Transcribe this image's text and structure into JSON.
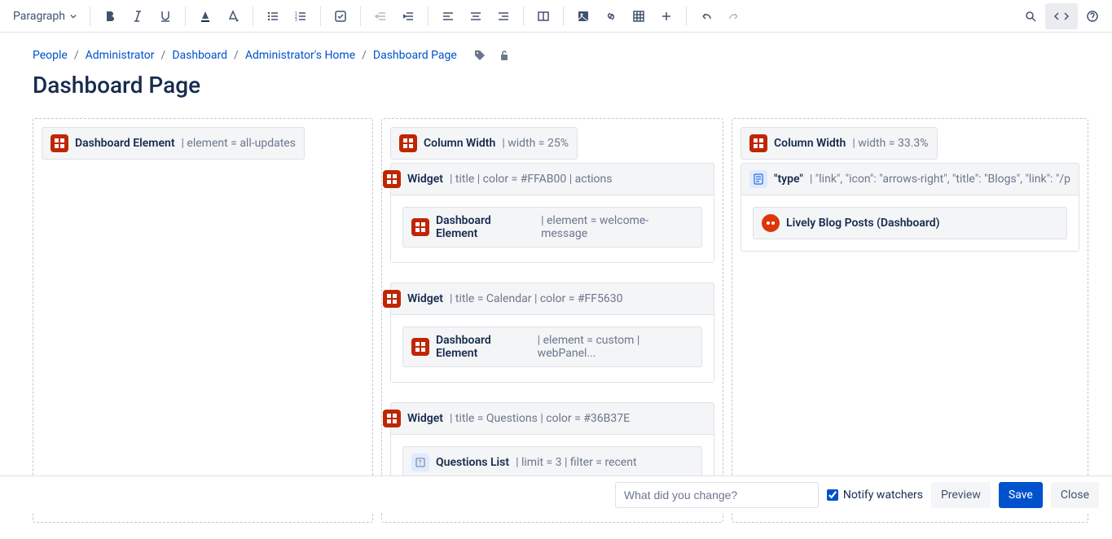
{
  "toolbar": {
    "style_select": "Paragraph"
  },
  "breadcrumb": [
    {
      "label": "People",
      "link": true
    },
    {
      "label": "Administrator",
      "link": true
    },
    {
      "label": "Dashboard",
      "link": true
    },
    {
      "label": "Administrator's Home",
      "link": true
    },
    {
      "label": "Dashboard Page",
      "link": true
    }
  ],
  "page_title": "Dashboard Page",
  "col1": {
    "macro1": {
      "title": "Dashboard Element",
      "params": "| element = all-updates"
    }
  },
  "col2": {
    "column_width": {
      "title": "Column Width",
      "params": "| width = 25%"
    },
    "widget1": {
      "title": "Widget",
      "params": "| title | color = #FFAB00 | actions",
      "inner_title": "Dashboard Element",
      "inner_params": "| element = welcome-message"
    },
    "widget2": {
      "title": "Widget",
      "params": "| title = Calendar | color = #FF5630",
      "inner_title": "Dashboard Element",
      "inner_params": "| element = custom | webPanel..."
    },
    "widget3": {
      "title": "Widget",
      "params": "| title = Questions | color = #36B37E",
      "inner_title": "Questions List",
      "inner_params": "| limit = 3 | filter = recent"
    }
  },
  "col3": {
    "column_width": {
      "title": "Column Width",
      "params": "| width = 33.3%"
    },
    "type_macro": {
      "title": "\"type\"",
      "params": "| \"link\", \"icon\": \"arrows-right\", \"title\": \"Blogs\", \"link\": \"/p",
      "inner_title": "Lively Blog Posts (Dashboard)"
    }
  },
  "footer": {
    "change_placeholder": "What did you change?",
    "notify_label": "Notify watchers",
    "preview": "Preview",
    "save": "Save",
    "close": "Close"
  }
}
